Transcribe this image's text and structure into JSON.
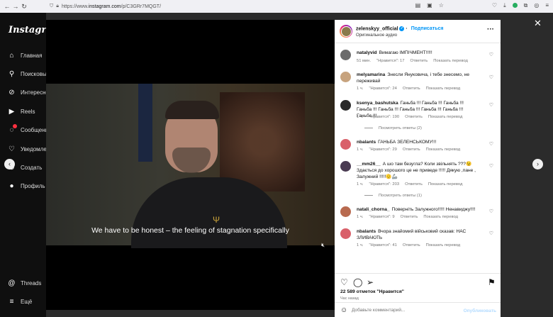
{
  "browser": {
    "url_prefix": "https://www.",
    "url_domain": "instagram.com",
    "url_path": "/p/C3GRr7MQGT/"
  },
  "sidebar": {
    "logo": "Instagram",
    "items": [
      {
        "label": "Главная",
        "icon": "home-icon"
      },
      {
        "label": "Поисковы",
        "icon": "search-icon"
      },
      {
        "label": "Интересно",
        "icon": "compass-icon"
      },
      {
        "label": "Reels",
        "icon": "reels-icon"
      },
      {
        "label": "Сообщени",
        "icon": "messenger-icon"
      },
      {
        "label": "Уведомле",
        "icon": "heart-icon"
      },
      {
        "label": "Создать",
        "icon": "plus-icon"
      },
      {
        "label": "Профиль",
        "icon": "profile-icon"
      }
    ],
    "bottom": [
      {
        "label": "Threads",
        "icon": "threads-icon"
      },
      {
        "label": "Ещё",
        "icon": "menu-icon"
      }
    ]
  },
  "video": {
    "subtitle": "We have to be honest – the feeling of stagnation specifically"
  },
  "post": {
    "username": "zelenskyy_official",
    "follow_label": "Подписаться",
    "audio": "Оригинальное аудио",
    "likes": "22 589 отметок \"Нравится\"",
    "time": "Час назад",
    "comment_placeholder": "Добавьте комментарий...",
    "publish_label": "Опубликовать"
  },
  "comments": [
    {
      "user": "natalyvid",
      "text": "Вимагаю ІМПІЧМЕНТ!!!!!",
      "time": "51 мин.",
      "likes": "\"Нравится\": 17",
      "reply": "Ответить",
      "translate": "Показать перевод",
      "avatar_color": "#6b6b6b"
    },
    {
      "user": "melyamarina",
      "text": "Знесли Януковича, і тебе знесемо, не переживай",
      "time": "1 ч.",
      "likes": "\"Нравится\": 24",
      "reply": "Ответить",
      "translate": "Показать перевод",
      "avatar_color": "#c7a37e"
    },
    {
      "user": "ksenya_bashutska",
      "text": "Ганьба !!! Ганьба !!! Ганьба !!! Ганьба !!! Ганьба !!! Ганьба !!! Ганьба !!! Ганьба !!! Ганьба !!!",
      "time": "1 ч.",
      "likes": "\"Нравится\": 190",
      "reply": "Ответить",
      "translate": "Показать перевод",
      "avatar_color": "#2a2a2a",
      "replies": "Посмотреть ответы (2)"
    },
    {
      "user": "nbalants",
      "text": "ГАНЬБА ЗЕЛЕНСЬКОМУ!!!",
      "time": "1 ч.",
      "likes": "\"Нравится\": 29",
      "reply": "Ответить",
      "translate": "Показать перевод",
      "avatar_color": "#d9606a"
    },
    {
      "user": "__mm26__",
      "text": "А шо там безугла? Коли звільнять ???😉 Здається до хорошого це не приведе !!!!! Дякую ,пане , Залужний !!!!!🫡🦾",
      "time": "1 ч.",
      "likes": "\"Нравится\": 203",
      "reply": "Ответить",
      "translate": "Показать перевод",
      "avatar_color": "#4a3b52",
      "replies": "Посмотреть ответы (1)"
    },
    {
      "user": "natali_chorna_",
      "text": "Поверніть Залужного!!!!! Ненавиджу!!!!",
      "time": "1 ч.",
      "likes": "\"Нравится\": 9",
      "reply": "Ответить",
      "translate": "Показать перевод",
      "avatar_color": "#b86a4f"
    },
    {
      "user": "nbalants",
      "text": "Вчора знайомий військовий сказав: НАС ЗЛИВАЮТЬ",
      "time": "1 ч.",
      "likes": "\"Нравится\": 41",
      "reply": "Ответить",
      "translate": "Показать перевод",
      "avatar_color": "#d9606a"
    }
  ]
}
